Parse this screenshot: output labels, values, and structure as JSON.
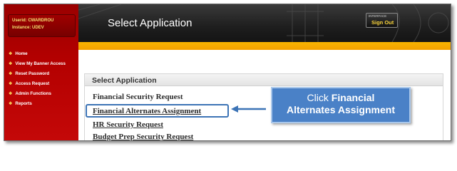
{
  "user": {
    "userid_label": "Userid:",
    "userid": "CWARDROU",
    "instance_label": "Instance:",
    "instance": "UDEV"
  },
  "nav": {
    "items": [
      {
        "label": "Home"
      },
      {
        "label": "View My Banner Access"
      },
      {
        "label": "Reset Password"
      },
      {
        "label": "Access Request"
      },
      {
        "label": "Admin Functions"
      },
      {
        "label": "Reports"
      }
    ]
  },
  "header": {
    "title": "Select Application",
    "signout_top": "INTERFACE",
    "signout_label": "Sign Out"
  },
  "panel": {
    "title": "Select Application",
    "links": [
      {
        "label": "Financial Security Request",
        "underlined": false
      },
      {
        "label": "Financial Alternates Assignment",
        "underlined": true
      },
      {
        "label": "HR Security Request",
        "underlined": true
      },
      {
        "label": "Budget Prep Security Request",
        "underlined": true
      }
    ]
  },
  "callout": {
    "prefix": "Click",
    "line1_bold": "Financial",
    "line2_bold": "Alternates Assignment"
  },
  "colors": {
    "sidebar": "#b30000",
    "header": "#1e1e1e",
    "gold_bar": "#f4a100",
    "callout": "#4a81c7",
    "highlight": "#3d74b6"
  }
}
